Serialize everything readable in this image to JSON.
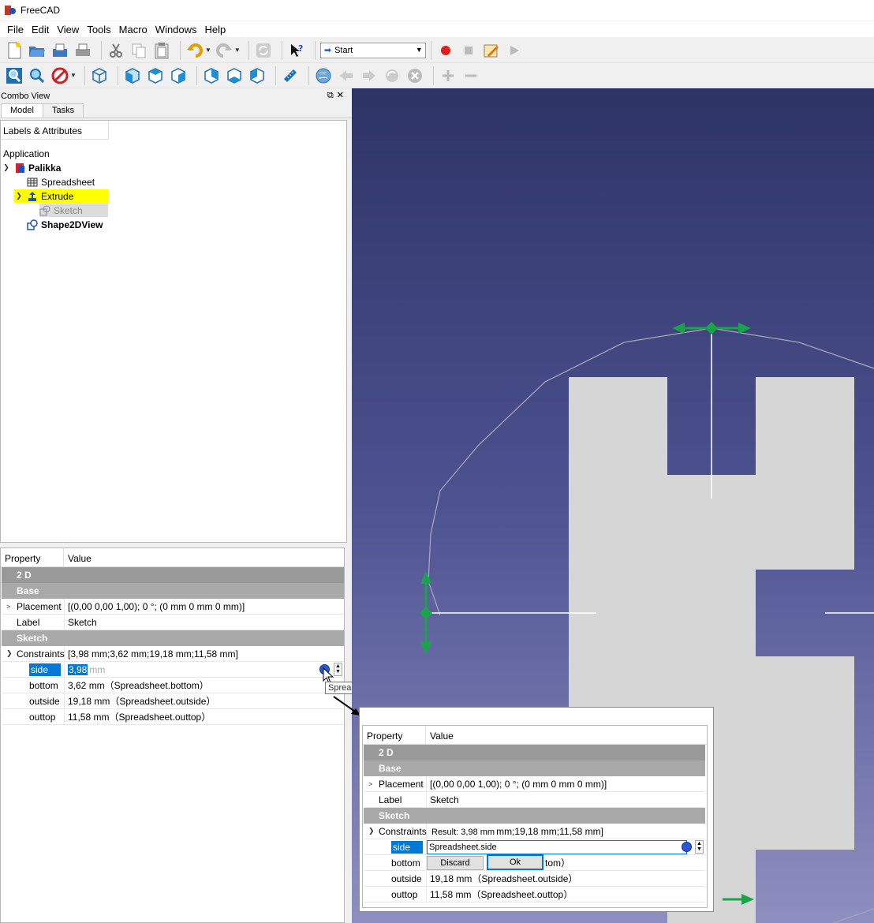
{
  "app": {
    "title": "FreeCAD"
  },
  "menu": [
    "File",
    "Edit",
    "View",
    "Tools",
    "Macro",
    "Windows",
    "Help"
  ],
  "toolbar": {
    "workbench": "Start"
  },
  "combo": {
    "title": "Combo View",
    "tabs": [
      "Model",
      "Tasks"
    ],
    "tree_header": "Labels & Attributes",
    "tree": {
      "root": "Application",
      "doc": "Palikka",
      "items": [
        "Spreadsheet",
        "Extrude",
        "Sketch",
        "Shape2DView"
      ]
    }
  },
  "properties": {
    "col_property": "Property",
    "col_value": "Value",
    "group_2d": "2 D",
    "group_base": "Base",
    "group_sketch": "Sketch",
    "placement_name": "Placement",
    "placement_value": "[(0,00 0,00 1,00); 0 °; (0 mm  0 mm  0 mm)]",
    "label_name": "Label",
    "label_value": "Sketch",
    "constraints_name": "Constraints",
    "constraints_value": "[3,98 mm;3,62 mm;19,18 mm;11,58 mm]",
    "side_name": "side",
    "side_value": "3,98",
    "side_unit": "mm",
    "bottom_name": "bottom",
    "bottom_value": "3,62 mm（Spreadsheet.bottom）",
    "outside_name": "outside",
    "outside_value": "19,18 mm（Spreadsheet.outside）",
    "outtop_name": "outtop",
    "outtop_value": "11,58 mm（Spreadsheet.outtop）",
    "tooltip": "Spreadsheet.side"
  },
  "inset": {
    "result": "Result: 3,98 mm",
    "constraints_tail": "mm;19,18 mm;11,58 mm]",
    "expression": "Spreadsheet.side",
    "bottom_tail": "tom）",
    "discard": "Discard",
    "ok": "Ok"
  },
  "colors": {
    "viewport_top": "#2e3366",
    "viewport_bottom": "#8e8fc0",
    "selection": "#0078d7",
    "highlight": "#ffff00",
    "manipulator": "#1aa34a"
  }
}
